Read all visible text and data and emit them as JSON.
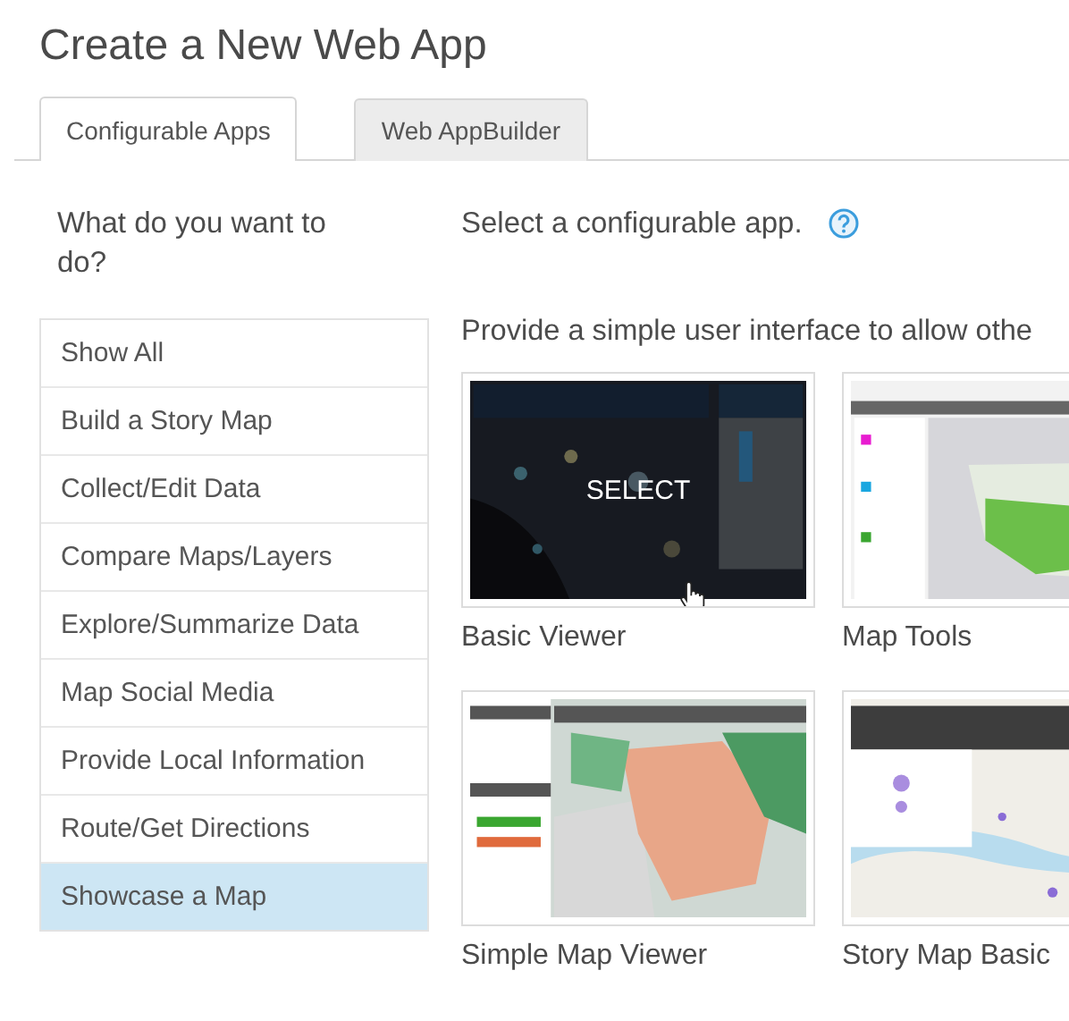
{
  "page_title": "Create a New Web App",
  "tabs": [
    {
      "label": "Configurable Apps",
      "selected": true
    },
    {
      "label": "Web AppBuilder",
      "selected": false
    }
  ],
  "sidebar": {
    "heading": "What do you want to do?",
    "items": [
      {
        "label": "Show All",
        "selected": false
      },
      {
        "label": "Build a Story Map",
        "selected": false
      },
      {
        "label": "Collect/Edit Data",
        "selected": false
      },
      {
        "label": "Compare Maps/Layers",
        "selected": false
      },
      {
        "label": "Explore/Summarize Data",
        "selected": false
      },
      {
        "label": "Map Social Media",
        "selected": false
      },
      {
        "label": "Provide Local Information",
        "selected": false
      },
      {
        "label": "Route/Get Directions",
        "selected": false
      },
      {
        "label": "Showcase a Map",
        "selected": true
      }
    ]
  },
  "content": {
    "prompt": "Select a configurable app.",
    "description": "Provide a simple user interface to allow othe",
    "apps": [
      {
        "title": "Basic Viewer",
        "hovered": true,
        "hover_label": "SELECT"
      },
      {
        "title": "Map Tools",
        "hovered": false
      },
      {
        "title": "Simple Map Viewer",
        "hovered": false
      },
      {
        "title": "Story Map Basic",
        "hovered": false
      }
    ]
  }
}
